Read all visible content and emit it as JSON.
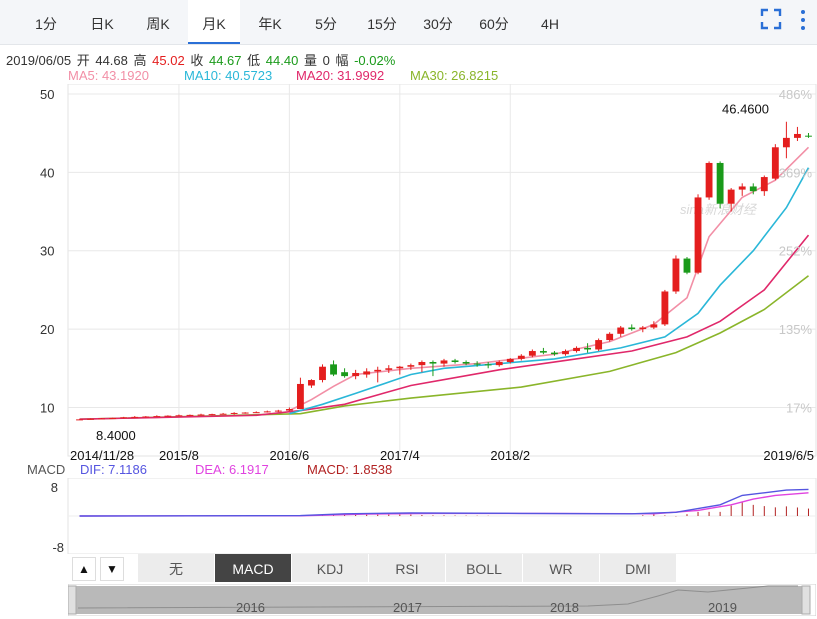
{
  "tabs": [
    {
      "label": "1分",
      "active": false
    },
    {
      "label": "日K",
      "active": false
    },
    {
      "label": "周K",
      "active": false
    },
    {
      "label": "月K",
      "active": true
    },
    {
      "label": "年K",
      "active": false
    },
    {
      "label": "5分",
      "active": false
    },
    {
      "label": "15分",
      "active": false
    },
    {
      "label": "30分",
      "active": false
    },
    {
      "label": "60分",
      "active": false
    },
    {
      "label": "4H",
      "active": false
    }
  ],
  "toolbar": {
    "expand_icon": "expand-icon",
    "more_icon": "more-vertical-icon"
  },
  "info": {
    "date": "2019/06/05",
    "open_label": "开",
    "open": "44.68",
    "high_label": "高",
    "high": "45.02",
    "close_label": "收",
    "close": "44.67",
    "low_label": "低",
    "low": "44.40",
    "vol_label": "量",
    "vol": "0",
    "chg_label": "幅",
    "chg": "-0.02%"
  },
  "ma": {
    "ma5": "MA5: 43.1920",
    "ma10": "MA10: 40.5723",
    "ma20": "MA20: 31.9992",
    "ma30": "MA30: 26.8215"
  },
  "watermark": "sina新浪财经",
  "colors": {
    "up": "#e41e1e",
    "down": "#1a9a1a",
    "ma5": "#f28fa6",
    "ma10": "#2ab7d8",
    "ma20": "#e0286a",
    "ma30": "#8ab52a",
    "dif": "#5555e0",
    "dea": "#e043e0",
    "macd": "#b22222",
    "grid": "#e8e8e8",
    "pct": "#c8c8c8"
  },
  "macd_info": {
    "label": "MACD",
    "dif": "DIF: 7.1186",
    "dea": "DEA: 6.1917",
    "macd": "MACD: 1.8538"
  },
  "macd_axis": [
    "8",
    "-8"
  ],
  "indicator_tabs": [
    {
      "label": "无",
      "active": false
    },
    {
      "label": "MACD",
      "active": true
    },
    {
      "label": "KDJ",
      "active": false
    },
    {
      "label": "RSI",
      "active": false
    },
    {
      "label": "BOLL",
      "active": false
    },
    {
      "label": "WR",
      "active": false
    },
    {
      "label": "DMI",
      "active": false
    }
  ],
  "nav_buttons": {
    "up": "▲",
    "down": "▼"
  },
  "navigator_labels": [
    "2016",
    "2017",
    "2018",
    "2019"
  ],
  "chart_data": {
    "type": "candlestick",
    "period": "monthly",
    "y_ticks": [
      50,
      40,
      30,
      20,
      10
    ],
    "pct_ticks": [
      "486%",
      "369%",
      "252%",
      "135%",
      "17%"
    ],
    "x_labels": [
      "2014/11/28",
      "2015/8",
      "2016/6",
      "2017/4",
      "2018/2",
      "2019/6/5"
    ],
    "max_label": "46.4600",
    "min_label": "8.4000",
    "ylim": [
      8.4,
      50
    ],
    "candles": [
      [
        8.45,
        8.5,
        8.4,
        8.48
      ],
      [
        8.5,
        8.6,
        8.45,
        8.55
      ],
      [
        8.55,
        8.65,
        8.5,
        8.6
      ],
      [
        8.6,
        8.7,
        8.55,
        8.65
      ],
      [
        8.65,
        8.8,
        8.6,
        8.75
      ],
      [
        8.75,
        8.9,
        8.7,
        8.8
      ],
      [
        8.8,
        8.9,
        8.7,
        8.85
      ],
      [
        8.85,
        9.0,
        8.8,
        8.9
      ],
      [
        8.9,
        9.0,
        8.8,
        8.95
      ],
      [
        8.95,
        9.1,
        8.9,
        9.0
      ],
      [
        9.0,
        9.1,
        8.9,
        9.05
      ],
      [
        9.05,
        9.2,
        9.0,
        9.1
      ],
      [
        9.1,
        9.2,
        9.0,
        9.15
      ],
      [
        9.15,
        9.3,
        9.1,
        9.2
      ],
      [
        9.2,
        9.4,
        9.1,
        9.3
      ],
      [
        9.3,
        9.4,
        9.2,
        9.35
      ],
      [
        9.35,
        9.5,
        9.3,
        9.4
      ],
      [
        9.4,
        9.6,
        9.35,
        9.5
      ],
      [
        9.5,
        9.7,
        9.4,
        9.6
      ],
      [
        9.6,
        10.0,
        9.5,
        9.8
      ],
      [
        9.8,
        13.8,
        9.8,
        13.0
      ],
      [
        12.8,
        13.6,
        12.5,
        13.5
      ],
      [
        13.5,
        15.5,
        13.2,
        15.2
      ],
      [
        15.5,
        16.0,
        14.0,
        14.2
      ],
      [
        14.5,
        15.0,
        13.8,
        14.0
      ],
      [
        14.0,
        14.8,
        13.6,
        14.4
      ],
      [
        14.2,
        15.0,
        13.8,
        14.6
      ],
      [
        14.6,
        15.2,
        13.2,
        14.8
      ],
      [
        14.8,
        15.4,
        14.4,
        15.0
      ],
      [
        15.0,
        15.3,
        14.2,
        15.2
      ],
      [
        15.2,
        15.6,
        14.8,
        15.4
      ],
      [
        15.4,
        16.0,
        14.5,
        15.8
      ],
      [
        15.8,
        16.0,
        14.0,
        15.6
      ],
      [
        15.6,
        16.2,
        15.2,
        16.0
      ],
      [
        16.0,
        16.2,
        15.6,
        15.8
      ],
      [
        15.8,
        16.0,
        15.4,
        15.6
      ],
      [
        15.6,
        15.9,
        15.2,
        15.5
      ],
      [
        15.5,
        15.8,
        15.0,
        15.4
      ],
      [
        15.4,
        16.0,
        15.2,
        15.8
      ],
      [
        15.8,
        16.3,
        15.6,
        16.2
      ],
      [
        16.2,
        16.8,
        16.0,
        16.6
      ],
      [
        16.6,
        17.4,
        16.4,
        17.2
      ],
      [
        17.2,
        17.6,
        16.8,
        17.0
      ],
      [
        17.0,
        17.2,
        16.6,
        16.8
      ],
      [
        16.8,
        17.4,
        16.6,
        17.2
      ],
      [
        17.2,
        17.8,
        17.0,
        17.6
      ],
      [
        17.6,
        18.2,
        17.0,
        17.4
      ],
      [
        17.4,
        18.8,
        17.2,
        18.6
      ],
      [
        18.6,
        19.6,
        18.4,
        19.4
      ],
      [
        19.4,
        20.4,
        19.0,
        20.2
      ],
      [
        20.2,
        20.6,
        19.8,
        20.0
      ],
      [
        20.0,
        20.4,
        19.6,
        20.2
      ],
      [
        20.2,
        21.0,
        20.0,
        20.6
      ],
      [
        20.6,
        25.0,
        20.4,
        24.8
      ],
      [
        24.8,
        29.4,
        24.5,
        29.0
      ],
      [
        29.0,
        29.2,
        27.0,
        27.2
      ],
      [
        27.2,
        37.2,
        27.0,
        36.8
      ],
      [
        36.8,
        41.4,
        36.5,
        41.2
      ],
      [
        41.2,
        41.4,
        35.4,
        36.0
      ],
      [
        36.0,
        38.0,
        35.0,
        37.8
      ],
      [
        37.8,
        38.6,
        37.0,
        38.2
      ],
      [
        38.2,
        38.6,
        37.2,
        37.6
      ],
      [
        37.6,
        39.6,
        37.0,
        39.4
      ],
      [
        39.2,
        43.6,
        39.0,
        43.2
      ],
      [
        43.2,
        46.46,
        41.8,
        44.4
      ],
      [
        44.4,
        45.8,
        44.0,
        44.9
      ],
      [
        44.68,
        45.02,
        44.4,
        44.67
      ]
    ],
    "ma5": [
      [
        19,
        9.6
      ],
      [
        21,
        11.0
      ],
      [
        23,
        12.7
      ],
      [
        25,
        14.2
      ],
      [
        30,
        15.0
      ],
      [
        36,
        15.6
      ],
      [
        43,
        16.8
      ],
      [
        48,
        18.4
      ],
      [
        52,
        20.6
      ],
      [
        55,
        24.0
      ],
      [
        57,
        31.8
      ],
      [
        60,
        36.8
      ],
      [
        63,
        39.0
      ],
      [
        66,
        43.2
      ]
    ],
    "ma10": [
      [
        19,
        9.2
      ],
      [
        22,
        10.4
      ],
      [
        25,
        11.8
      ],
      [
        30,
        14.2
      ],
      [
        33,
        15.0
      ],
      [
        43,
        16.2
      ],
      [
        49,
        17.6
      ],
      [
        53,
        19.0
      ],
      [
        56,
        22.0
      ],
      [
        58,
        25.6
      ],
      [
        61,
        30.0
      ],
      [
        64,
        35.5
      ],
      [
        66,
        40.6
      ]
    ],
    "ma20": [
      [
        0,
        8.5
      ],
      [
        16,
        9.0
      ],
      [
        20,
        9.6
      ],
      [
        24,
        10.4
      ],
      [
        30,
        12.8
      ],
      [
        38,
        14.8
      ],
      [
        44,
        16.0
      ],
      [
        50,
        17.2
      ],
      [
        55,
        19.0
      ],
      [
        58,
        21.0
      ],
      [
        62,
        25.0
      ],
      [
        66,
        32.0
      ]
    ],
    "ma30": [
      [
        0,
        8.5
      ],
      [
        20,
        9.2
      ],
      [
        24,
        10.2
      ],
      [
        30,
        11.2
      ],
      [
        40,
        12.6
      ],
      [
        48,
        14.6
      ],
      [
        54,
        17.0
      ],
      [
        58,
        19.5
      ],
      [
        62,
        22.5
      ],
      [
        66,
        26.8
      ]
    ],
    "macd": {
      "ylim": [
        -8,
        8
      ],
      "dif": [
        [
          0,
          0
        ],
        [
          20,
          0.1
        ],
        [
          24,
          0.6
        ],
        [
          30,
          0.8
        ],
        [
          40,
          0.7
        ],
        [
          50,
          0.6
        ],
        [
          54,
          1.0
        ],
        [
          58,
          3.0
        ],
        [
          60,
          5.5
        ],
        [
          62,
          6.2
        ],
        [
          64,
          6.9
        ],
        [
          66,
          7.1
        ]
      ],
      "dea": [
        [
          0,
          0
        ],
        [
          20,
          0.05
        ],
        [
          26,
          0.5
        ],
        [
          32,
          0.7
        ],
        [
          42,
          0.7
        ],
        [
          52,
          0.6
        ],
        [
          56,
          1.5
        ],
        [
          59,
          3.0
        ],
        [
          61,
          4.5
        ],
        [
          63,
          5.5
        ],
        [
          66,
          6.2
        ]
      ]
    }
  }
}
